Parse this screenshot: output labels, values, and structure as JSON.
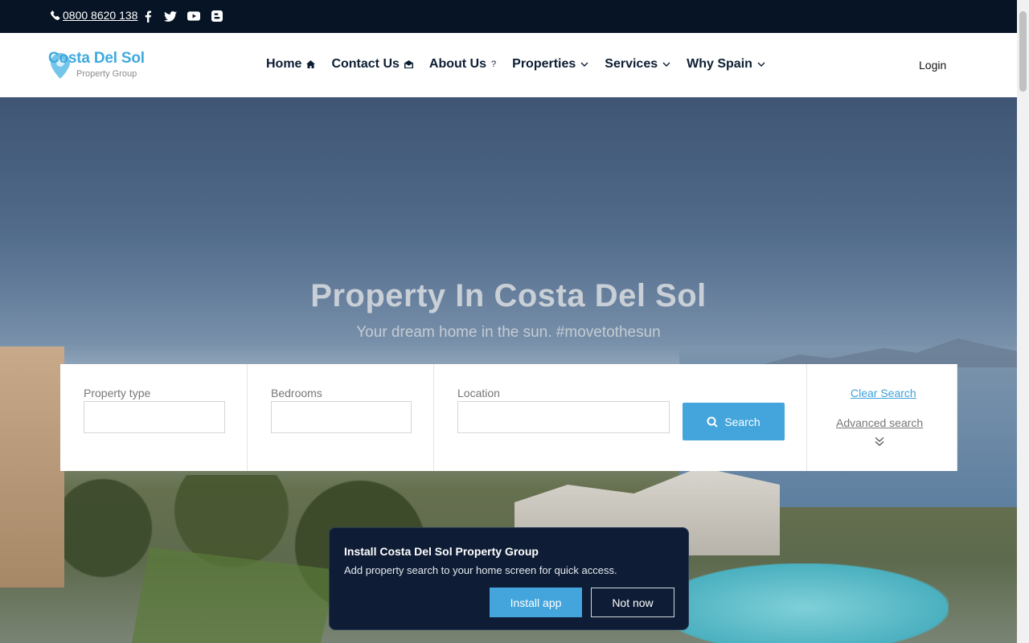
{
  "topbar": {
    "phone": "0800 8620 138",
    "social_icons": [
      "facebook-icon",
      "twitter-icon",
      "youtube-icon",
      "blogger-icon"
    ],
    "background": "#071426"
  },
  "header": {
    "logo_brand": "Costa Del Sol",
    "logo_sub": "Property Group",
    "nav": [
      {
        "label": "Home",
        "icon": "home-icon"
      },
      {
        "label": "Contact Us",
        "icon": "envelope-open-icon"
      },
      {
        "label": "About Us",
        "icon": "question-icon"
      },
      {
        "label": "Properties",
        "icon": "chevron-down-icon"
      },
      {
        "label": "Services",
        "icon": "chevron-down-icon"
      },
      {
        "label": "Why Spain",
        "icon": "chevron-down-icon"
      }
    ],
    "login": "Login"
  },
  "hero": {
    "title": "Property In Costa Del Sol",
    "subtitle": "Your dream home in the sun. #movetothesun"
  },
  "search": {
    "property_type_label": "Property type",
    "bedrooms_label": "Bedrooms",
    "location_label": "Location",
    "search_button": "Search",
    "clear_search": "Clear Search",
    "advanced_search": "Advanced search",
    "accent": "#44a5dc"
  },
  "install_prompt": {
    "title": "Install Costa Del Sol Property Group",
    "description": "Add property search to your home screen for quick access.",
    "install_button": "Install app",
    "dismiss_button": "Not now"
  }
}
